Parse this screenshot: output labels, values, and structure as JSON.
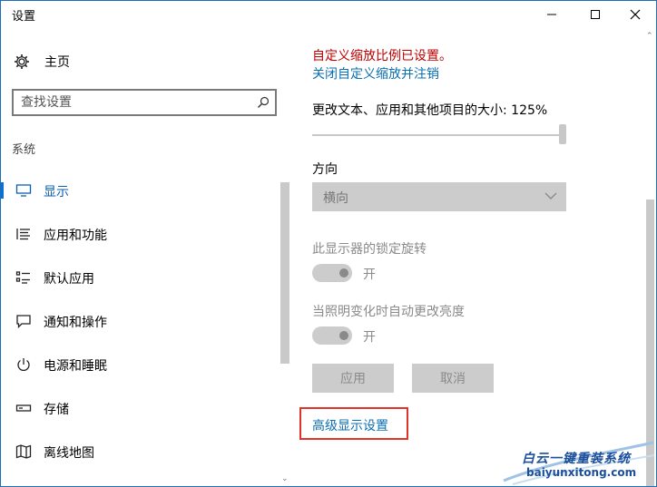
{
  "window": {
    "title": "设置"
  },
  "sidebar": {
    "home_label": "主页",
    "search_placeholder": "查找设置",
    "section_label": "系统",
    "items": [
      {
        "label": "显示",
        "icon": "monitor-icon",
        "active": true
      },
      {
        "label": "应用和功能",
        "icon": "list-icon"
      },
      {
        "label": "默认应用",
        "icon": "default-apps-icon"
      },
      {
        "label": "通知和操作",
        "icon": "message-icon"
      },
      {
        "label": "电源和睡眠",
        "icon": "power-icon"
      },
      {
        "label": "存储",
        "icon": "storage-icon"
      },
      {
        "label": "离线地图",
        "icon": "map-icon"
      }
    ]
  },
  "display": {
    "custom_scale_warning": "自定义缩放比例已设置。",
    "signout_link": "关闭自定义缩放并注销",
    "scale_label": "更改文本、应用和其他项目的大小: 125%",
    "scale_slider_value": 1.0,
    "orientation_label": "方向",
    "orientation_value": "横向",
    "lock_rotation_label": "此显示器的锁定旋转",
    "lock_rotation_state": "开",
    "auto_brightness_label": "当照明变化时自动更改亮度",
    "auto_brightness_state": "开",
    "apply_button": "应用",
    "cancel_button": "取消",
    "advanced_link": "高级显示设置"
  },
  "watermark": {
    "brand": "白云一键重装系统",
    "url": "baiyunxitong.com"
  },
  "colors": {
    "accent": "#0a6fd6",
    "link": "#0a6fb4",
    "warning": "#c00000",
    "highlight_box": "#e0332a"
  }
}
